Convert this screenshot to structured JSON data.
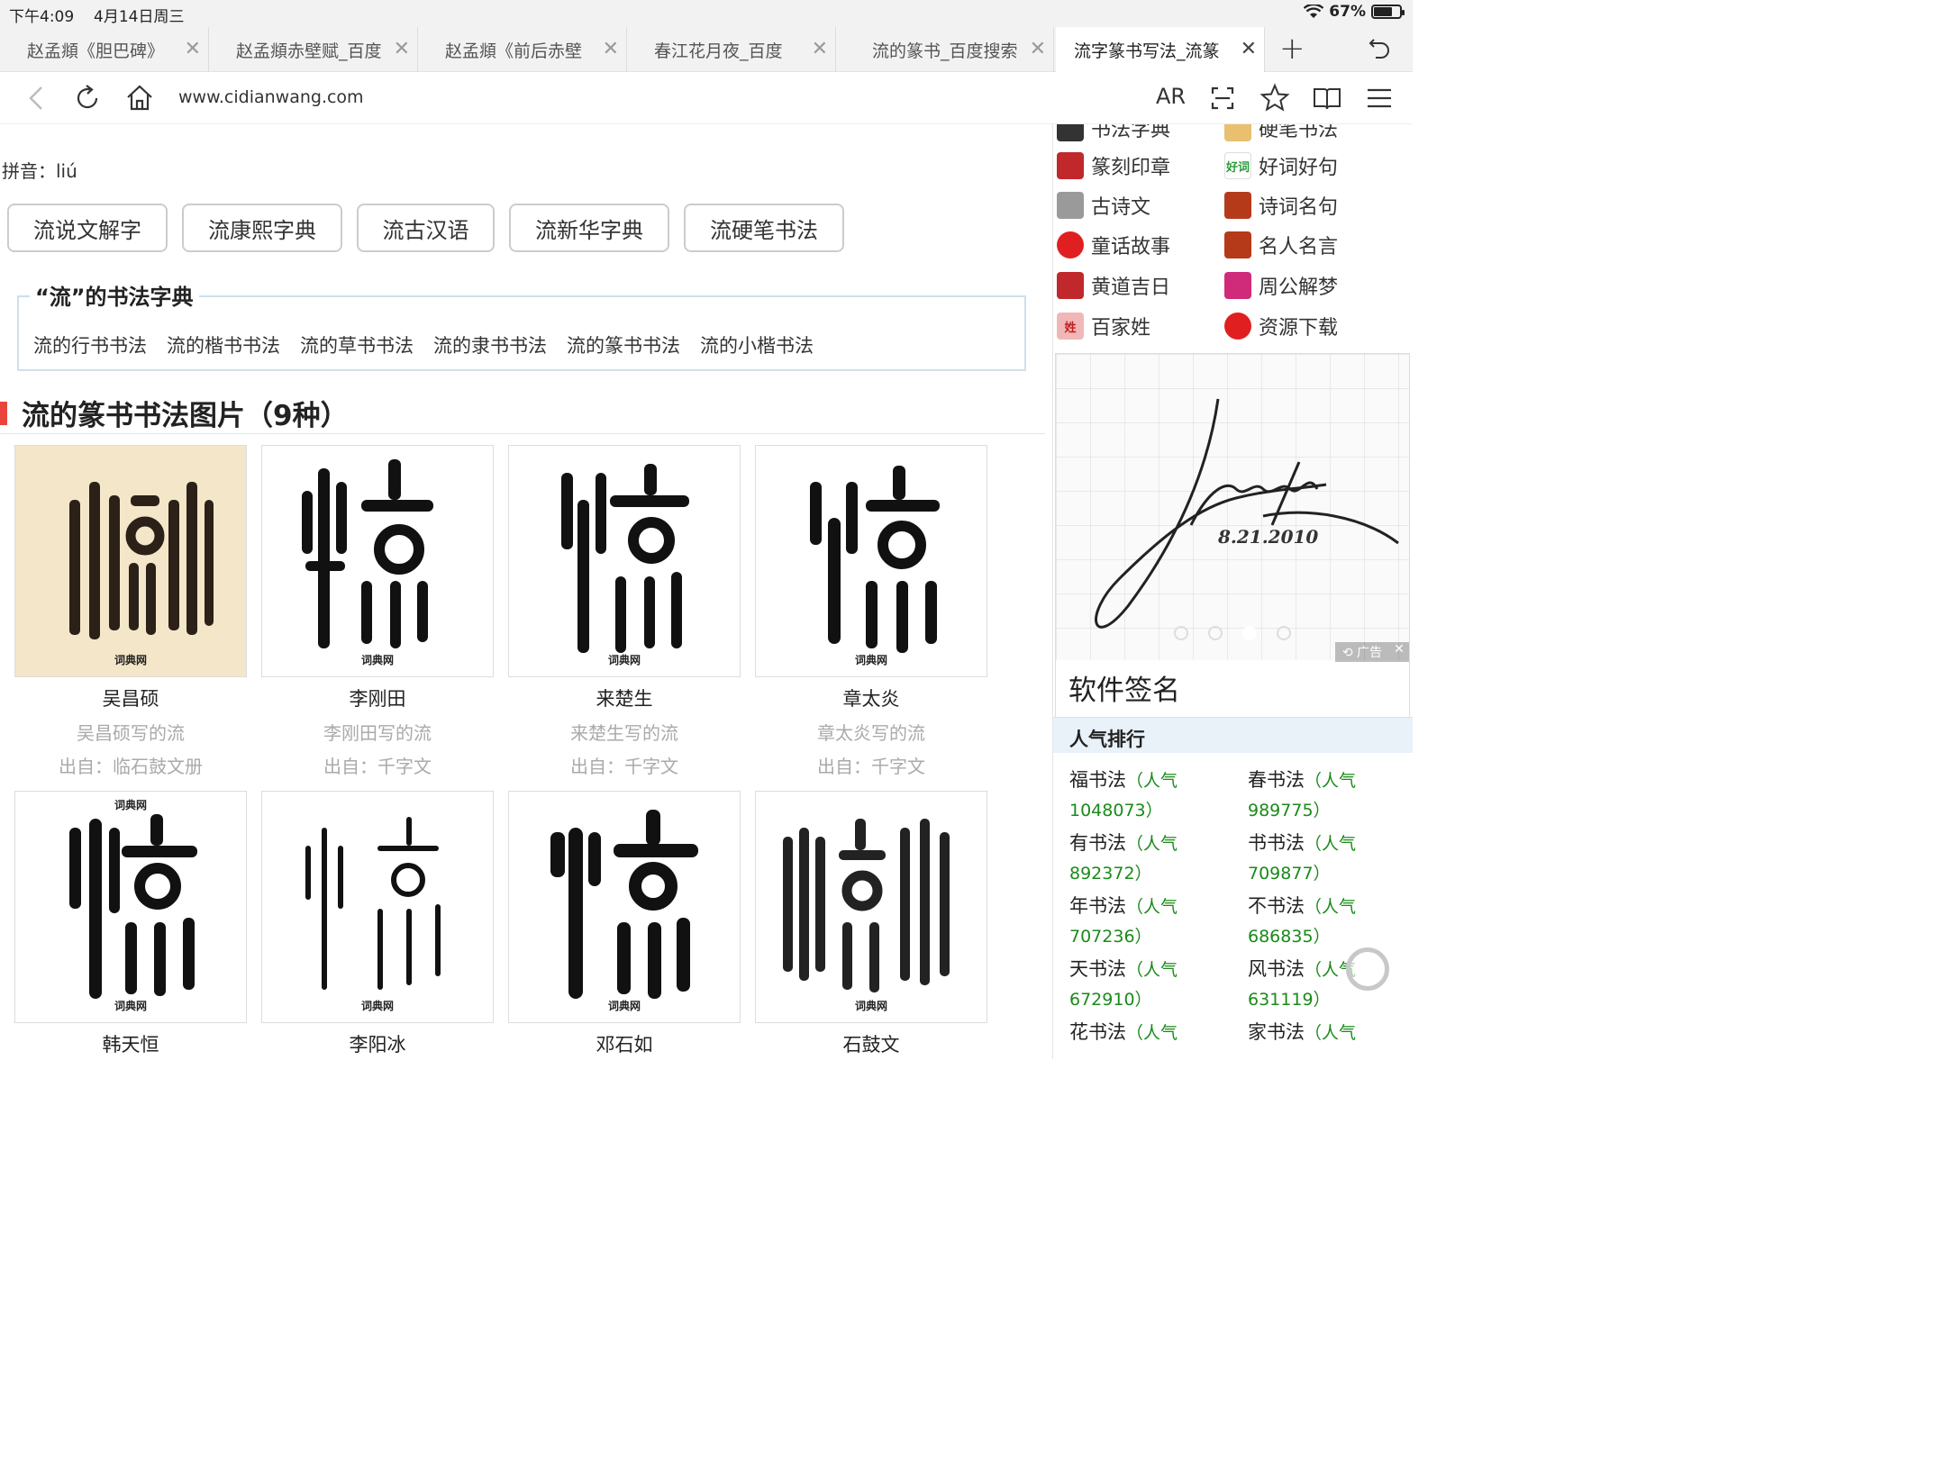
{
  "status": {
    "time": "下午4:09",
    "date": "4月14日周三",
    "battery": "67%",
    "battery_level": 0.67
  },
  "tabs": [
    {
      "label": "赵孟頫《胆巴碑》",
      "active": false
    },
    {
      "label": "赵孟頫赤壁赋_百度",
      "active": false
    },
    {
      "label": "赵孟頫《前后赤壁",
      "active": false
    },
    {
      "label": "春江花月夜_百度",
      "active": false
    },
    {
      "label": "流的篆书_百度搜索",
      "active": false
    },
    {
      "label": "流字篆书写法_流篆",
      "active": true
    }
  ],
  "toolbar": {
    "url": "www.cidianwang.com",
    "ar_label": "AR"
  },
  "page": {
    "pinyin": "拼音：liú",
    "chips": [
      "流说文解字",
      "流康熙字典",
      "流古汉语",
      "流新华字典",
      "流硬笔书法"
    ],
    "dict": {
      "legend": "“流”的书法字典",
      "links": [
        "流的行书书法",
        "流的楷书书法",
        "流的草书书法",
        "流的隶书书法",
        "流的篆书书法",
        "流的小楷书法"
      ]
    },
    "section_title": "流的篆书书法图片（9种）",
    "watermark": "词典网",
    "cards": [
      {
        "name": "吴昌硕",
        "desc": "吴昌硕写的流",
        "source": "出自：临石鼓文册"
      },
      {
        "name": "李刚田",
        "desc": "李刚田写的流",
        "source": "出自：千字文"
      },
      {
        "name": "来楚生",
        "desc": "来楚生写的流",
        "source": "出自：千字文"
      },
      {
        "name": "章太炎",
        "desc": "章太炎写的流",
        "source": "出自：千字文"
      },
      {
        "name": "韩天恒"
      },
      {
        "name": "李阳冰"
      },
      {
        "name": "邓石如"
      },
      {
        "name": "石鼓文"
      }
    ]
  },
  "sidebar": {
    "nav_partial": [
      "书法字典",
      "硬笔书法"
    ],
    "nav": [
      {
        "label": "篆刻印章",
        "icon": "seal-icon",
        "color": "#c0282b"
      },
      {
        "label": "好词好句",
        "icon": "words-icon",
        "color": "#2a9a3a",
        "icon_text": "好词"
      },
      {
        "label": "古诗文",
        "icon": "scholar-icon",
        "color": "#8a8a8a"
      },
      {
        "label": "诗词名句",
        "icon": "poem-icon",
        "color": "#b53a1a"
      },
      {
        "label": "童话故事",
        "icon": "flower-icon",
        "color": "#e02020"
      },
      {
        "label": "名人名言",
        "icon": "quote-icon",
        "color": "#b53a1a"
      },
      {
        "label": "黄道吉日",
        "icon": "calendar-icon",
        "color": "#c0282b"
      },
      {
        "label": "周公解梦",
        "icon": "dream-icon",
        "color": "#d02a7a"
      },
      {
        "label": "百家姓",
        "icon": "surname-icon",
        "color": "#e0404a",
        "icon_text": "姓"
      },
      {
        "label": "资源下载",
        "icon": "flower-icon",
        "color": "#e02020"
      }
    ],
    "ad": {
      "caption": "软件签名",
      "tag": "广告",
      "signature_date": "8.21.2010",
      "slide_count": 4,
      "active_slide": 3
    },
    "ranking": {
      "title": "人气排行",
      "items": [
        {
          "word": "福书法",
          "count": "（人气1048073）"
        },
        {
          "word": "春书法",
          "count": "（人气989775）"
        },
        {
          "word": "有书法",
          "count": "（人气892372）"
        },
        {
          "word": "书书法",
          "count": "（人气709877）"
        },
        {
          "word": "年书法",
          "count": "（人气707236）"
        },
        {
          "word": "不书法",
          "count": "（人气686835）"
        },
        {
          "word": "天书法",
          "count": "（人气672910）"
        },
        {
          "word": "风书法",
          "count": "（人气631119）"
        },
        {
          "word": "花书法",
          "count": "（人气"
        },
        {
          "word": "家书法",
          "count": "（人气"
        }
      ]
    }
  }
}
